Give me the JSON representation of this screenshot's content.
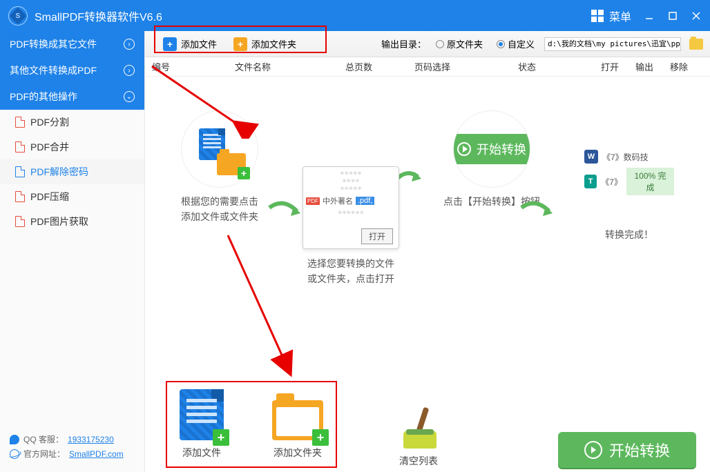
{
  "titlebar": {
    "title": "SmallPDF转换器软件V6.6",
    "menu_label": "菜单"
  },
  "sidebar": {
    "sections": [
      {
        "label": "PDF转换成其它文件",
        "chev": "›"
      },
      {
        "label": "其他文件转换成PDF",
        "chev": "›"
      },
      {
        "label": "PDF的其他操作",
        "chev": "⌄"
      }
    ],
    "items": [
      {
        "label": "PDF分割"
      },
      {
        "label": "PDF合并"
      },
      {
        "label": "PDF解除密码"
      },
      {
        "label": "PDF压缩"
      },
      {
        "label": "PDF图片获取"
      }
    ],
    "footer": {
      "qq_label": "QQ 客服：",
      "qq_link": "1933175230",
      "site_label": "官方网址：",
      "site_link": "SmallPDF.com"
    }
  },
  "toolbar": {
    "add_file": "添加文件",
    "add_folder": "添加文件夹",
    "output_label": "输出目录：",
    "radio_original": "原文件夹",
    "radio_custom": "自定义",
    "path_value": "d:\\我的文档\\my pictures\\迅宜\\ppt"
  },
  "columns": {
    "c1": "编号",
    "c2": "文件名称",
    "c3": "总页数",
    "c4": "页码选择",
    "c5": "状态",
    "c6": "打开",
    "c7": "输出",
    "c8": "移除"
  },
  "guide": {
    "step1": "根据您的需要点击\n添加文件或文件夹",
    "step2": "选择您要转换的文件\n或文件夹，点击打开",
    "step2_file": "中外著名",
    "step2_ext": ".pdf,",
    "step2_open": "打开",
    "step3_btn": "开始转换",
    "step3_cap": "点击【开始转换】按钮",
    "step4_row1": "《7》数码技",
    "step4_row2": "《7》",
    "step4_done": "100% 完成",
    "step4_cap": "转换完成！"
  },
  "bottom": {
    "add_file": "添加文件",
    "add_folder": "添加文件夹",
    "clear": "清空列表",
    "start": "开始转换"
  }
}
